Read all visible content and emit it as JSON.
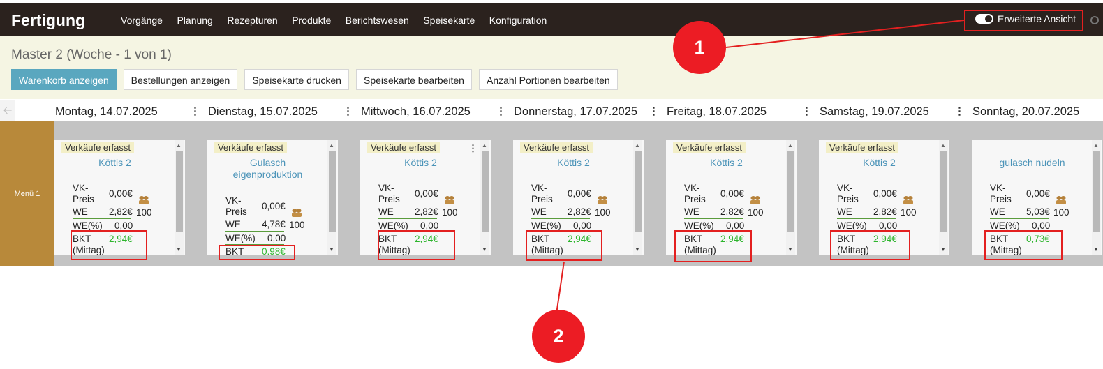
{
  "app": {
    "brand": "Fertigung"
  },
  "nav": [
    "Vorgänge",
    "Planung",
    "Rezepturen",
    "Produkte",
    "Berichtswesen",
    "Speisekarte",
    "Konfiguration"
  ],
  "toggle": {
    "label": "Erweiterte Ansicht",
    "on": true
  },
  "master": {
    "title": "Master 2  (Woche - 1 von 1)"
  },
  "buttons": {
    "warenkorb": "Warenkorb anzeigen",
    "bestellungen": "Bestellungen anzeigen",
    "drucken": "Speisekarte drucken",
    "bearbeiten": "Speisekarte bearbeiten",
    "portionen": "Anzahl Portionen bearbeiten"
  },
  "menu_row": {
    "label": "Menü 1"
  },
  "labels": {
    "sales": "Verkäufe erfasst",
    "vk1": "VK-",
    "vk2": "Preis",
    "we": "WE",
    "wep": "WE(%)",
    "bkt": "BKT",
    "mittag": "(Mittag)",
    "dots": "⋮"
  },
  "days": [
    {
      "name": "Montag, 14.07.2025",
      "dish": "Köttis 2",
      "vk": "0,00€",
      "we": "2,82€",
      "wep": "0,00",
      "bkt": "2,94€",
      "qty": "100",
      "mittag": true,
      "sales": true
    },
    {
      "name": "Dienstag, 15.07.2025",
      "dish": "Gulasch eigenproduktion",
      "vk": "0,00€",
      "we": "4,78€",
      "wep": "0,00",
      "bkt": "0,98€",
      "qty": "100",
      "mittag": false,
      "sales": true
    },
    {
      "name": "Mittwoch, 16.07.2025",
      "dish": "Köttis 2",
      "vk": "0,00€",
      "we": "2,82€",
      "wep": "0,00",
      "bkt": "2,94€",
      "qty": "100",
      "mittag": true,
      "sales": true
    },
    {
      "name": "Donnerstag, 17.07.2025",
      "dish": "Köttis 2",
      "vk": "0,00€",
      "we": "2,82€",
      "wep": "0,00",
      "bkt": "2,94€",
      "qty": "100",
      "mittag": true,
      "sales": true
    },
    {
      "name": "Freitag, 18.07.2025",
      "dish": "Köttis 2",
      "vk": "0,00€",
      "we": "2,82€",
      "wep": "0,00",
      "bkt": "2,94€",
      "qty": "100",
      "mittag": true,
      "sales": true
    },
    {
      "name": "Samstag, 19.07.2025",
      "dish": "Köttis 2",
      "vk": "0,00€",
      "we": "2,82€",
      "wep": "0,00",
      "bkt": "2,94€",
      "qty": "100",
      "mittag": true,
      "sales": true
    },
    {
      "name": "Sonntag, 20.07.2025",
      "dish": "gulasch nudeln",
      "vk": "0,00€",
      "we": "5,03€",
      "wep": "0,00",
      "bkt": "0,73€",
      "qty": "100",
      "mittag": true,
      "sales": false
    }
  ],
  "callouts": [
    "1",
    "2"
  ],
  "colors": {
    "topbar": "#2b221e",
    "accent": "#5aa7bf",
    "menu": "#b8893a",
    "green": "#2db52d",
    "annotation": "#ec1c24"
  }
}
